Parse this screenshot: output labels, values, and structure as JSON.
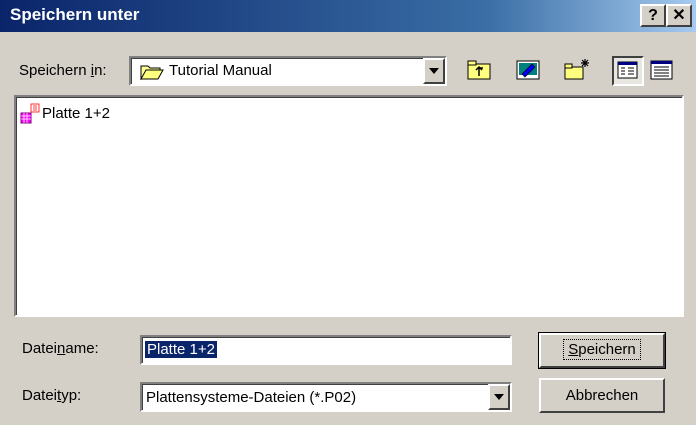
{
  "window": {
    "title": "Speichern unter",
    "help_label": "?",
    "close_label": "✕"
  },
  "save_in": {
    "label_pre": "Speichern ",
    "label_accel": "i",
    "label_post": "n:",
    "folder": "Tutorial Manual"
  },
  "toolbar": {
    "icons": [
      "folder-up-icon",
      "desktop-icon",
      "new-folder-icon",
      "list-view-icon",
      "details-view-icon"
    ]
  },
  "files": [
    {
      "name": "Platte 1+2",
      "icon": "plate-file-icon"
    }
  ],
  "filename": {
    "label_pre": "Datei",
    "label_accel": "n",
    "label_post": "ame:",
    "value": "Platte 1+2"
  },
  "filetype": {
    "label_pre": "Datei",
    "label_accel": "t",
    "label_post": "yp:",
    "value": "Plattensysteme-Dateien (*.P02)"
  },
  "buttons": {
    "save_accel": "S",
    "save_rest": "peichern",
    "cancel": "Abbrechen"
  }
}
